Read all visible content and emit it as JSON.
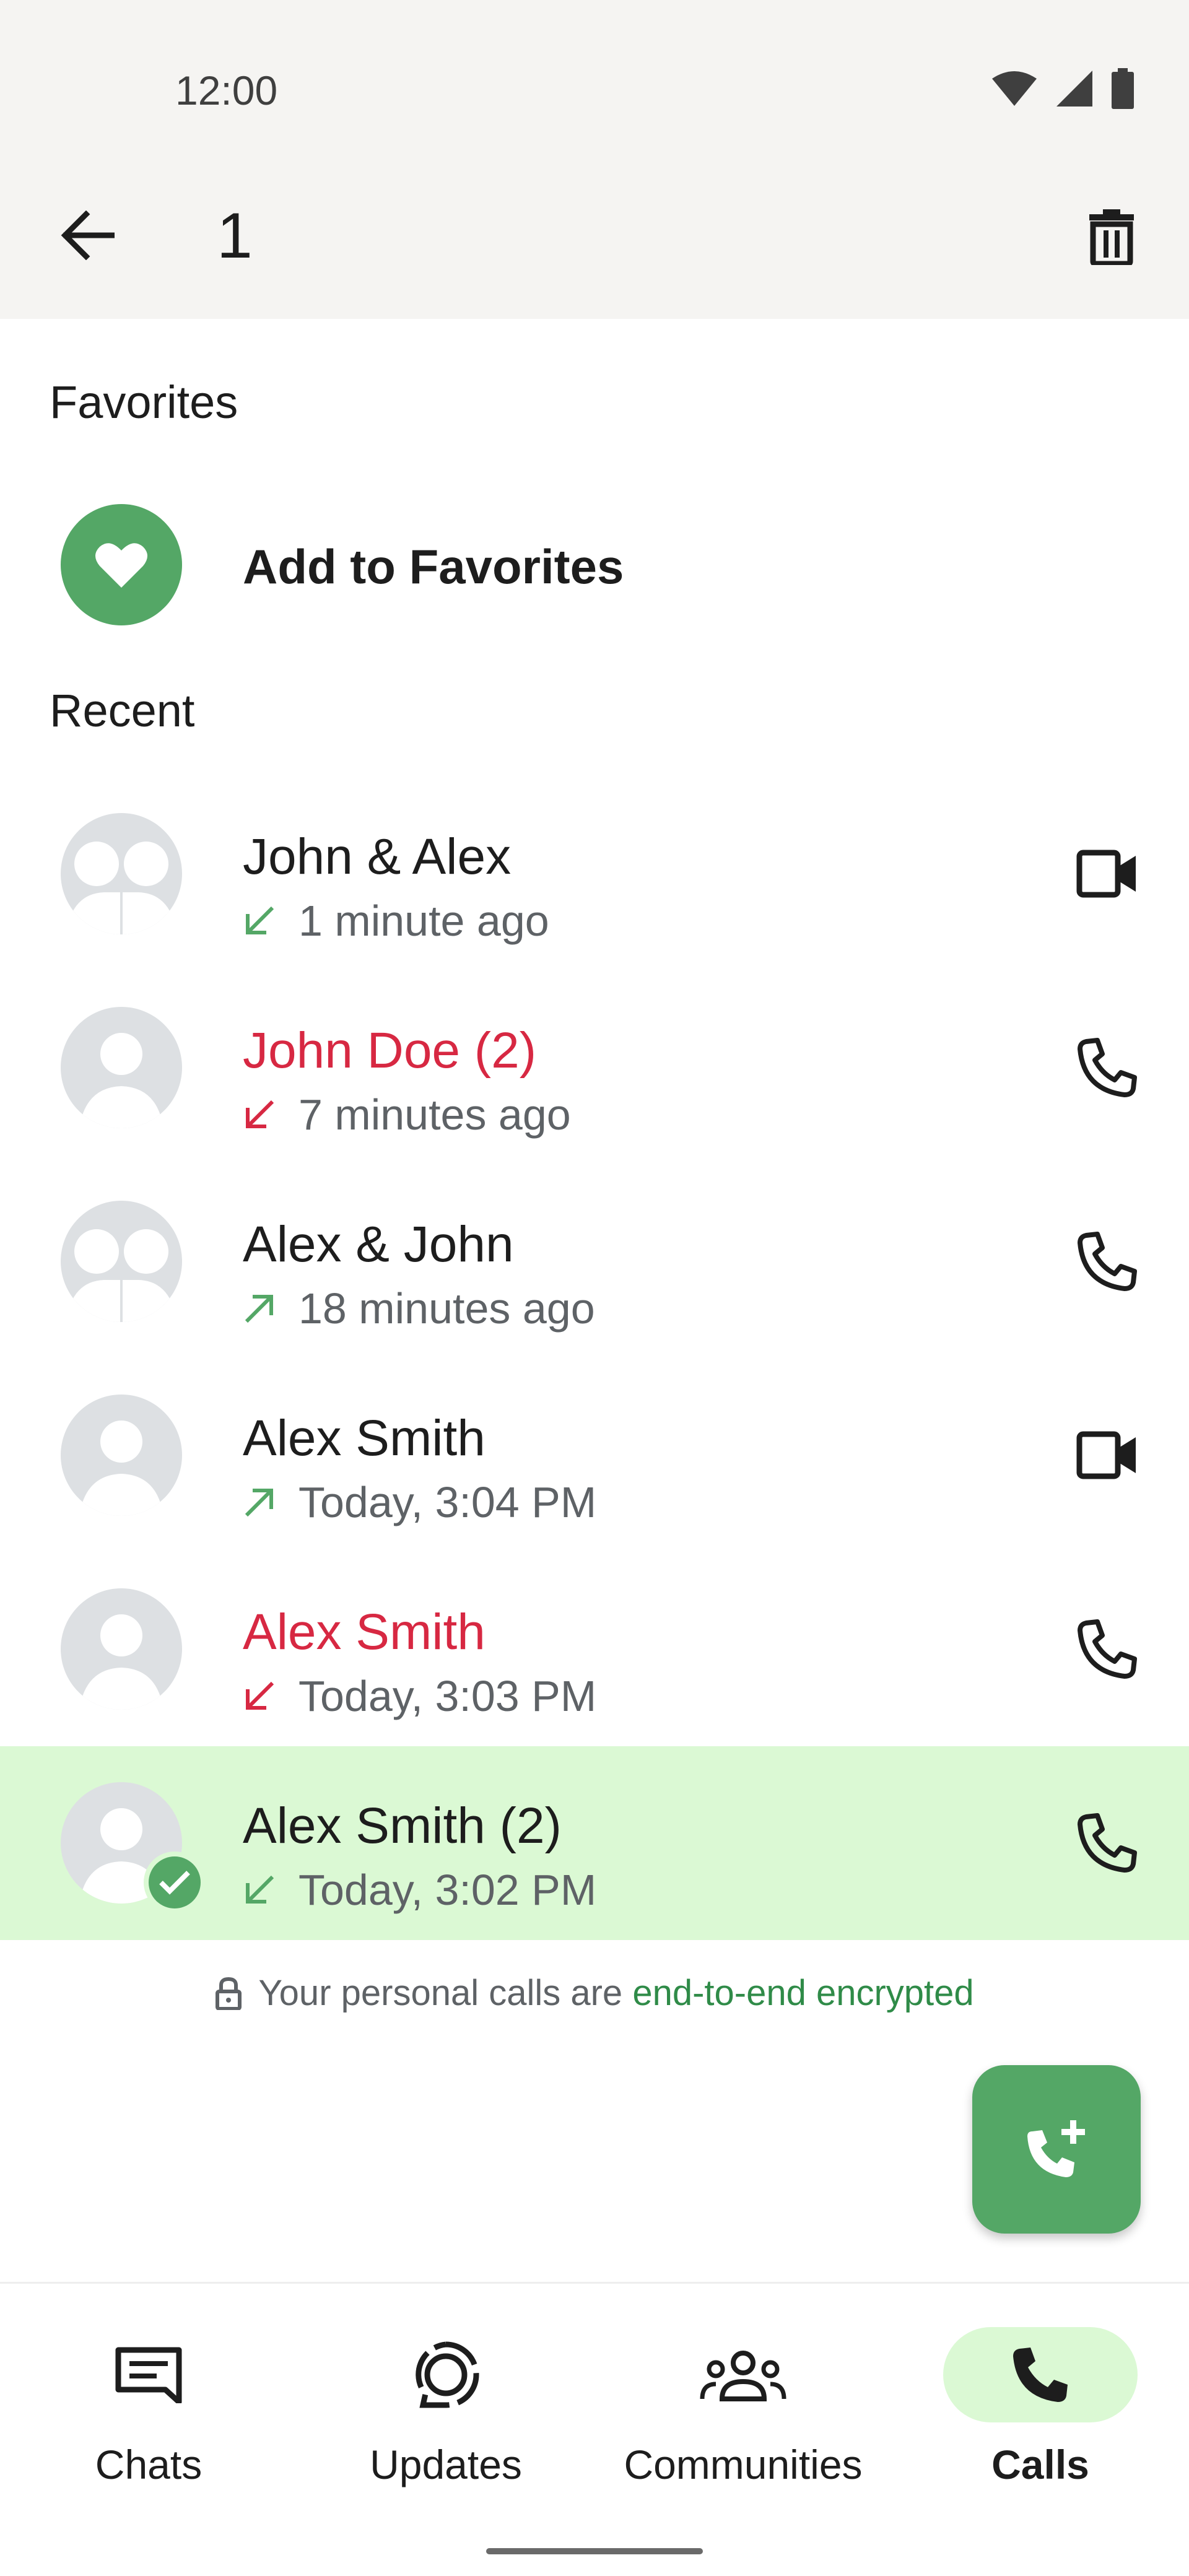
{
  "status_bar": {
    "time": "12:00",
    "icons": [
      "wifi-icon",
      "signal-icon",
      "battery-icon"
    ]
  },
  "app_bar": {
    "selected_count": "1",
    "back_icon": "arrow-back-icon",
    "delete_icon": "trash-icon"
  },
  "favorites": {
    "header": "Favorites",
    "add_label": "Add to Favorites",
    "icon": "heart-icon"
  },
  "recent": {
    "header": "Recent",
    "calls": [
      {
        "name": "John & Alex",
        "time": "1 minute ago",
        "direction": "incoming",
        "missed": false,
        "type": "video",
        "group": true,
        "selected": false
      },
      {
        "name": "John Doe (2)",
        "time": "7 minutes ago",
        "direction": "incoming",
        "missed": true,
        "type": "voice",
        "group": false,
        "selected": false
      },
      {
        "name": "Alex & John",
        "time": "18 minutes ago",
        "direction": "outgoing",
        "missed": false,
        "type": "voice",
        "group": true,
        "selected": false
      },
      {
        "name": "Alex Smith",
        "time": "Today, 3:04 PM",
        "direction": "outgoing",
        "missed": false,
        "type": "video",
        "group": false,
        "selected": false
      },
      {
        "name": "Alex Smith",
        "time": "Today, 3:03 PM",
        "direction": "incoming",
        "missed": true,
        "type": "voice",
        "group": false,
        "selected": false
      },
      {
        "name": "Alex Smith (2)",
        "time": "Today, 3:02 PM",
        "direction": "incoming",
        "missed": false,
        "type": "voice",
        "group": false,
        "selected": true
      }
    ]
  },
  "encryption": {
    "text": "Your personal calls are",
    "link": "end-to-end encrypted"
  },
  "fab": {
    "icon": "add-call-icon"
  },
  "bottom_nav": {
    "items": [
      {
        "label": "Chats",
        "icon": "chats-icon",
        "active": false
      },
      {
        "label": "Updates",
        "icon": "updates-icon",
        "active": false
      },
      {
        "label": "Communities",
        "icon": "communities-icon",
        "active": false
      },
      {
        "label": "Calls",
        "icon": "calls-icon",
        "active": true
      }
    ]
  },
  "colors": {
    "accent": "#54a766",
    "selected_bg": "#dbf9d4",
    "missed": "#d72842",
    "link": "#2f8b48"
  }
}
